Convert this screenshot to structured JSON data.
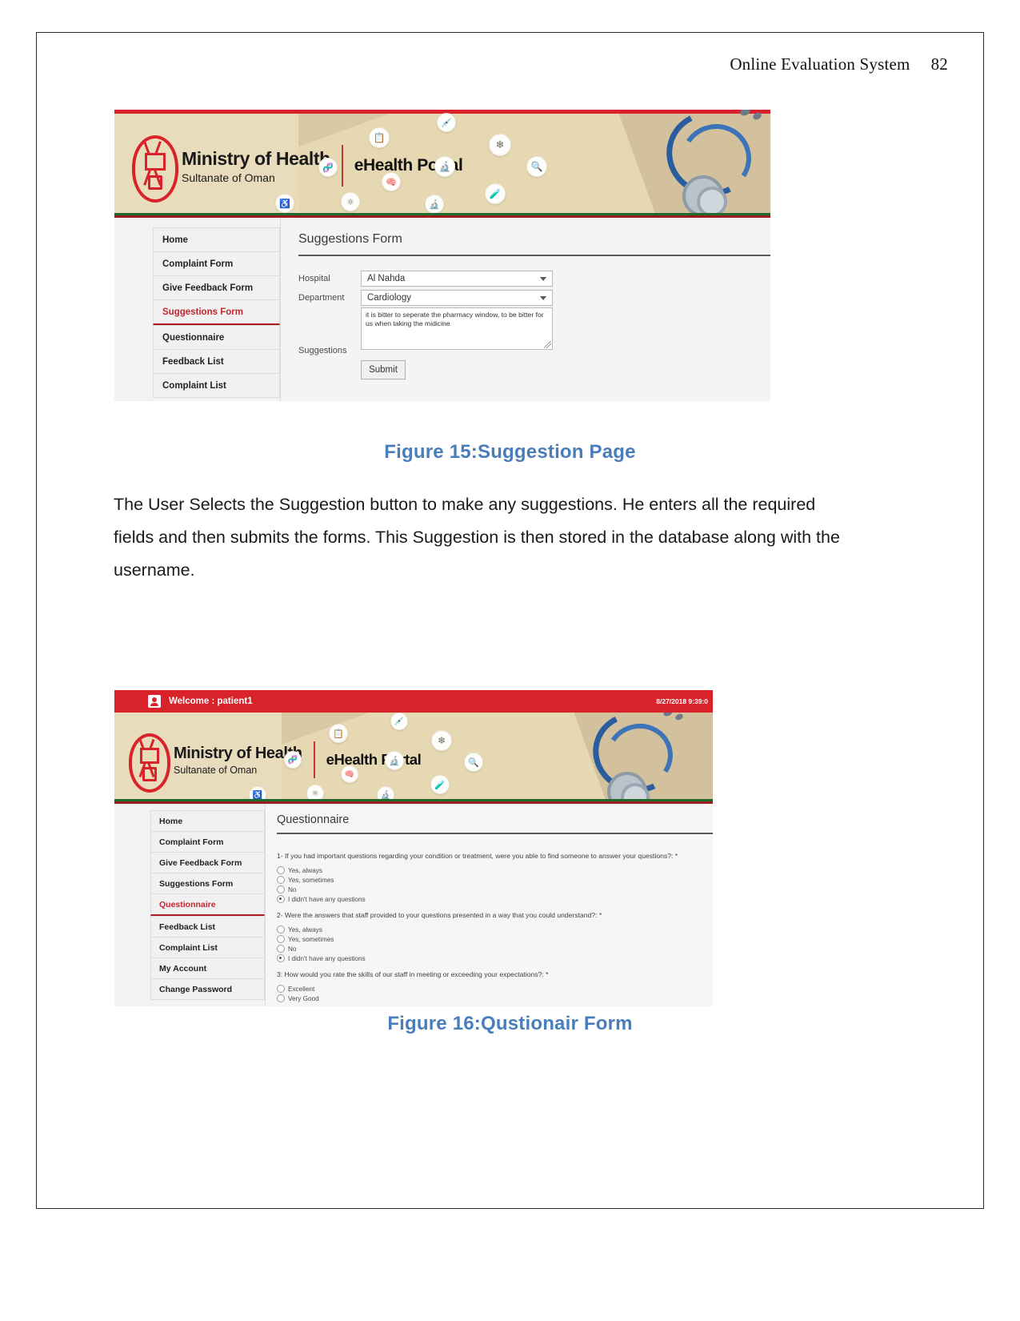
{
  "document": {
    "header_title": "Online Evaluation System",
    "page_number": "82"
  },
  "figure15": {
    "caption": "Figure 15:Suggestion Page",
    "banner": {
      "ministry_line1": "Ministry of Health",
      "ministry_line2": "Sultanate of Oman",
      "portal": "eHealth Portal",
      "icons": [
        "clipboard-icon",
        "syringe-icon",
        "snowflake-icon",
        "dna-icon",
        "flask-icon",
        "magnifier-icon",
        "brain-icon",
        "test-tubes-icon",
        "wheelchair-icon",
        "molecule-icon",
        "microscope-icon"
      ]
    },
    "sidebar": {
      "items": [
        {
          "label": "Home",
          "active": false
        },
        {
          "label": "Complaint Form",
          "active": false
        },
        {
          "label": "Give Feedback Form",
          "active": false
        },
        {
          "label": "Suggestions Form",
          "active": true
        },
        {
          "label": "Questionnaire",
          "active": false
        },
        {
          "label": "Feedback List",
          "active": false
        },
        {
          "label": "Complaint List",
          "active": false
        }
      ]
    },
    "form": {
      "title": "Suggestions Form",
      "hospital_label": "Hospital",
      "hospital_value": "Al Nahda",
      "department_label": "Department",
      "department_value": "Cardiology",
      "suggestions_label": "Suggestions",
      "suggestions_value": "it is bitter to seperate the pharmacy window, to be bitter for us when taking the midicine",
      "submit_label": "Submit"
    }
  },
  "body_text": "The User Selects the Suggestion button to make any suggestions. He enters all the required fields and then submits the forms. This Suggestion is then stored in the database along with the username.",
  "figure16": {
    "caption": "Figure 16:Qustionair Form",
    "topbar": {
      "welcome": "Welcome : patient1",
      "timestamp": "8/27/2018 9:39:0"
    },
    "banner": {
      "ministry_line1": "Ministry of Health",
      "ministry_line2": "Sultanate of Oman",
      "portal": "eHealth Portal"
    },
    "sidebar": {
      "items": [
        {
          "label": "Home",
          "active": false
        },
        {
          "label": "Complaint Form",
          "active": false
        },
        {
          "label": "Give Feedback Form",
          "active": false
        },
        {
          "label": "Suggestions Form",
          "active": false
        },
        {
          "label": "Questionnaire",
          "active": true
        },
        {
          "label": "Feedback List",
          "active": false
        },
        {
          "label": "Complaint List",
          "active": false
        },
        {
          "label": "My Account",
          "active": false
        },
        {
          "label": "Change Password",
          "active": false
        }
      ]
    },
    "form": {
      "title": "Questionnaire",
      "questions": [
        {
          "text": "1- If you had important questions regarding your condition or treatment, were you able to find someone to answer your questions?: *",
          "options": [
            {
              "label": "Yes, always",
              "selected": false
            },
            {
              "label": "Yes, sometimes",
              "selected": false
            },
            {
              "label": "No",
              "selected": false
            },
            {
              "label": "I didn't have any questions",
              "selected": true
            }
          ]
        },
        {
          "text": "2- Were the answers that staff provided to your questions presented in a way that you could understand?: *",
          "options": [
            {
              "label": "Yes, always",
              "selected": false
            },
            {
              "label": "Yes, sometimes",
              "selected": false
            },
            {
              "label": "No",
              "selected": false
            },
            {
              "label": "I didn't have any questions",
              "selected": true
            }
          ]
        },
        {
          "text": "3: How would you rate the skills of our staff in meeting or exceeding your expectations?: *",
          "options": [
            {
              "label": "Excellent",
              "selected": false
            },
            {
              "label": "Very Good",
              "selected": false
            }
          ]
        }
      ]
    }
  }
}
